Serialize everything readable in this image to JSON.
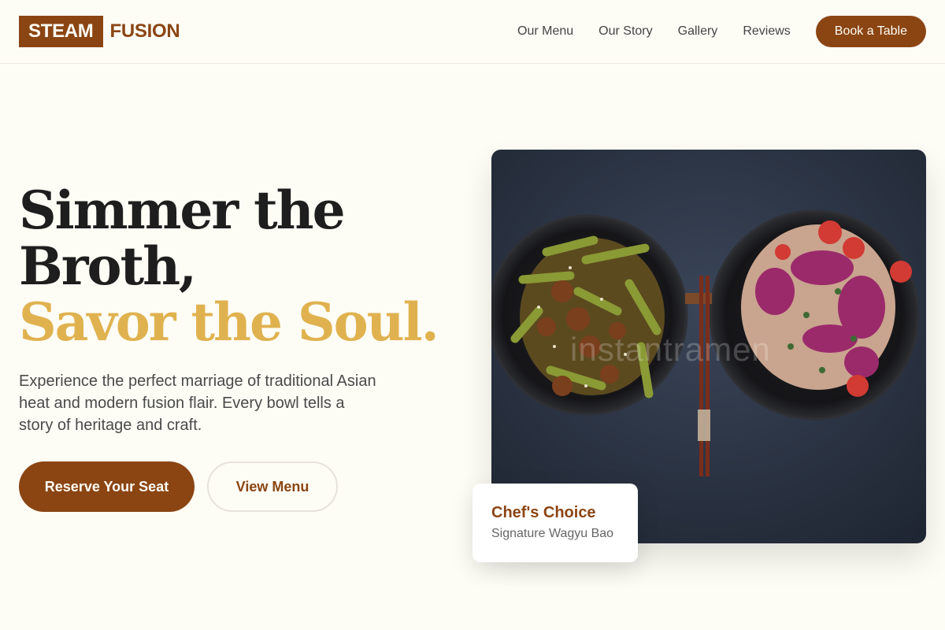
{
  "brand": {
    "logo_box": "STEAM",
    "logo_text": "FUSION"
  },
  "nav": {
    "items": [
      {
        "label": "Our Menu"
      },
      {
        "label": "Our Story"
      },
      {
        "label": "Gallery"
      },
      {
        "label": "Reviews"
      }
    ],
    "cta": "Book a Table"
  },
  "hero": {
    "title_line1": "Simmer the",
    "title_line2": "Broth,",
    "title_accent": "Savor the Soul.",
    "description": "Experience the perfect marriage of traditional Asian heat and modern fusion flair. Every bowl tells a story of heritage and craft.",
    "primary_button": "Reserve Your Seat",
    "secondary_button": "View Menu",
    "image_watermark": "instantramen"
  },
  "feature_card": {
    "title": "Chef's Choice",
    "subtitle": "Signature Wagyu Bao"
  },
  "colors": {
    "brand": "#8b4513",
    "accent": "#e0b24f",
    "background": "#fdfcf5"
  }
}
